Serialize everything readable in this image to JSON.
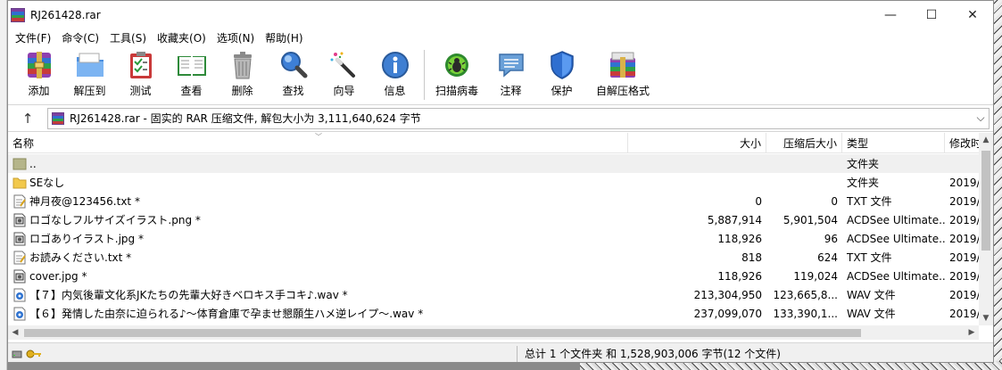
{
  "window": {
    "title": "RJ261428.rar",
    "controls": {
      "minimize": "—",
      "maximize": "☐",
      "close": "✕"
    }
  },
  "menu": [
    "文件(F)",
    "命令(C)",
    "工具(S)",
    "收藏夹(O)",
    "选项(N)",
    "帮助(H)"
  ],
  "toolbar": {
    "add": "添加",
    "extract_to": "解压到",
    "test": "测试",
    "view": "查看",
    "delete": "删除",
    "find": "查找",
    "wizard": "向导",
    "info": "信息",
    "virus_scan": "扫描病毒",
    "comment": "注释",
    "protect": "保护",
    "sfx": "自解压格式"
  },
  "address": {
    "up": "↑",
    "text": "RJ261428.rar - 固实的 RAR 压缩文件, 解包大小为 3,111,640,624 字节"
  },
  "columns": {
    "name": "名称",
    "size": "大小",
    "packed": "压缩后大小",
    "type": "类型",
    "modified": "修改时"
  },
  "files": [
    {
      "name": "..",
      "size": "",
      "packed": "",
      "type": "文件夹",
      "modified": "",
      "icon": "parent-folder-icon"
    },
    {
      "name": "SEなし",
      "size": "",
      "packed": "",
      "type": "文件夹",
      "modified": "2019/",
      "icon": "folder-icon"
    },
    {
      "name": "神月夜@123456.txt *",
      "size": "0",
      "packed": "0",
      "type": "TXT 文件",
      "modified": "2019/",
      "icon": "text-file-icon"
    },
    {
      "name": "ロゴなしフルサイズイラスト.png *",
      "size": "5,887,914",
      "packed": "5,901,504",
      "type": "ACDSee Ultimate...",
      "modified": "2019/",
      "icon": "image-file-icon"
    },
    {
      "name": "ロゴありイラスト.jpg *",
      "size": "118,926",
      "packed": "96",
      "type": "ACDSee Ultimate...",
      "modified": "2019/",
      "icon": "image-file-icon"
    },
    {
      "name": "お読みください.txt *",
      "size": "818",
      "packed": "624",
      "type": "TXT 文件",
      "modified": "2019/",
      "icon": "text-file-icon"
    },
    {
      "name": "cover.jpg *",
      "size": "118,926",
      "packed": "119,024",
      "type": "ACDSee Ultimate...",
      "modified": "2019/",
      "icon": "image-file-icon"
    },
    {
      "name": "【７】内気後輩文化系JKたちの先輩大好きベロキス手コキ♪.wav *",
      "size": "213,304,950",
      "packed": "123,665,8...",
      "type": "WAV 文件",
      "modified": "2019/",
      "icon": "audio-file-icon"
    },
    {
      "name": "【６】発情した由奈に迫られる♪～体育倉庫で孕ませ懇願生ハメ逆レイプ～.wav *",
      "size": "237,099,070",
      "packed": "133,390,1...",
      "type": "WAV 文件",
      "modified": "2019/",
      "icon": "audio-file-icon"
    }
  ],
  "status": {
    "summary": "总计 1 个文件夹 和 1,528,903,006 字节(12 个文件)"
  }
}
